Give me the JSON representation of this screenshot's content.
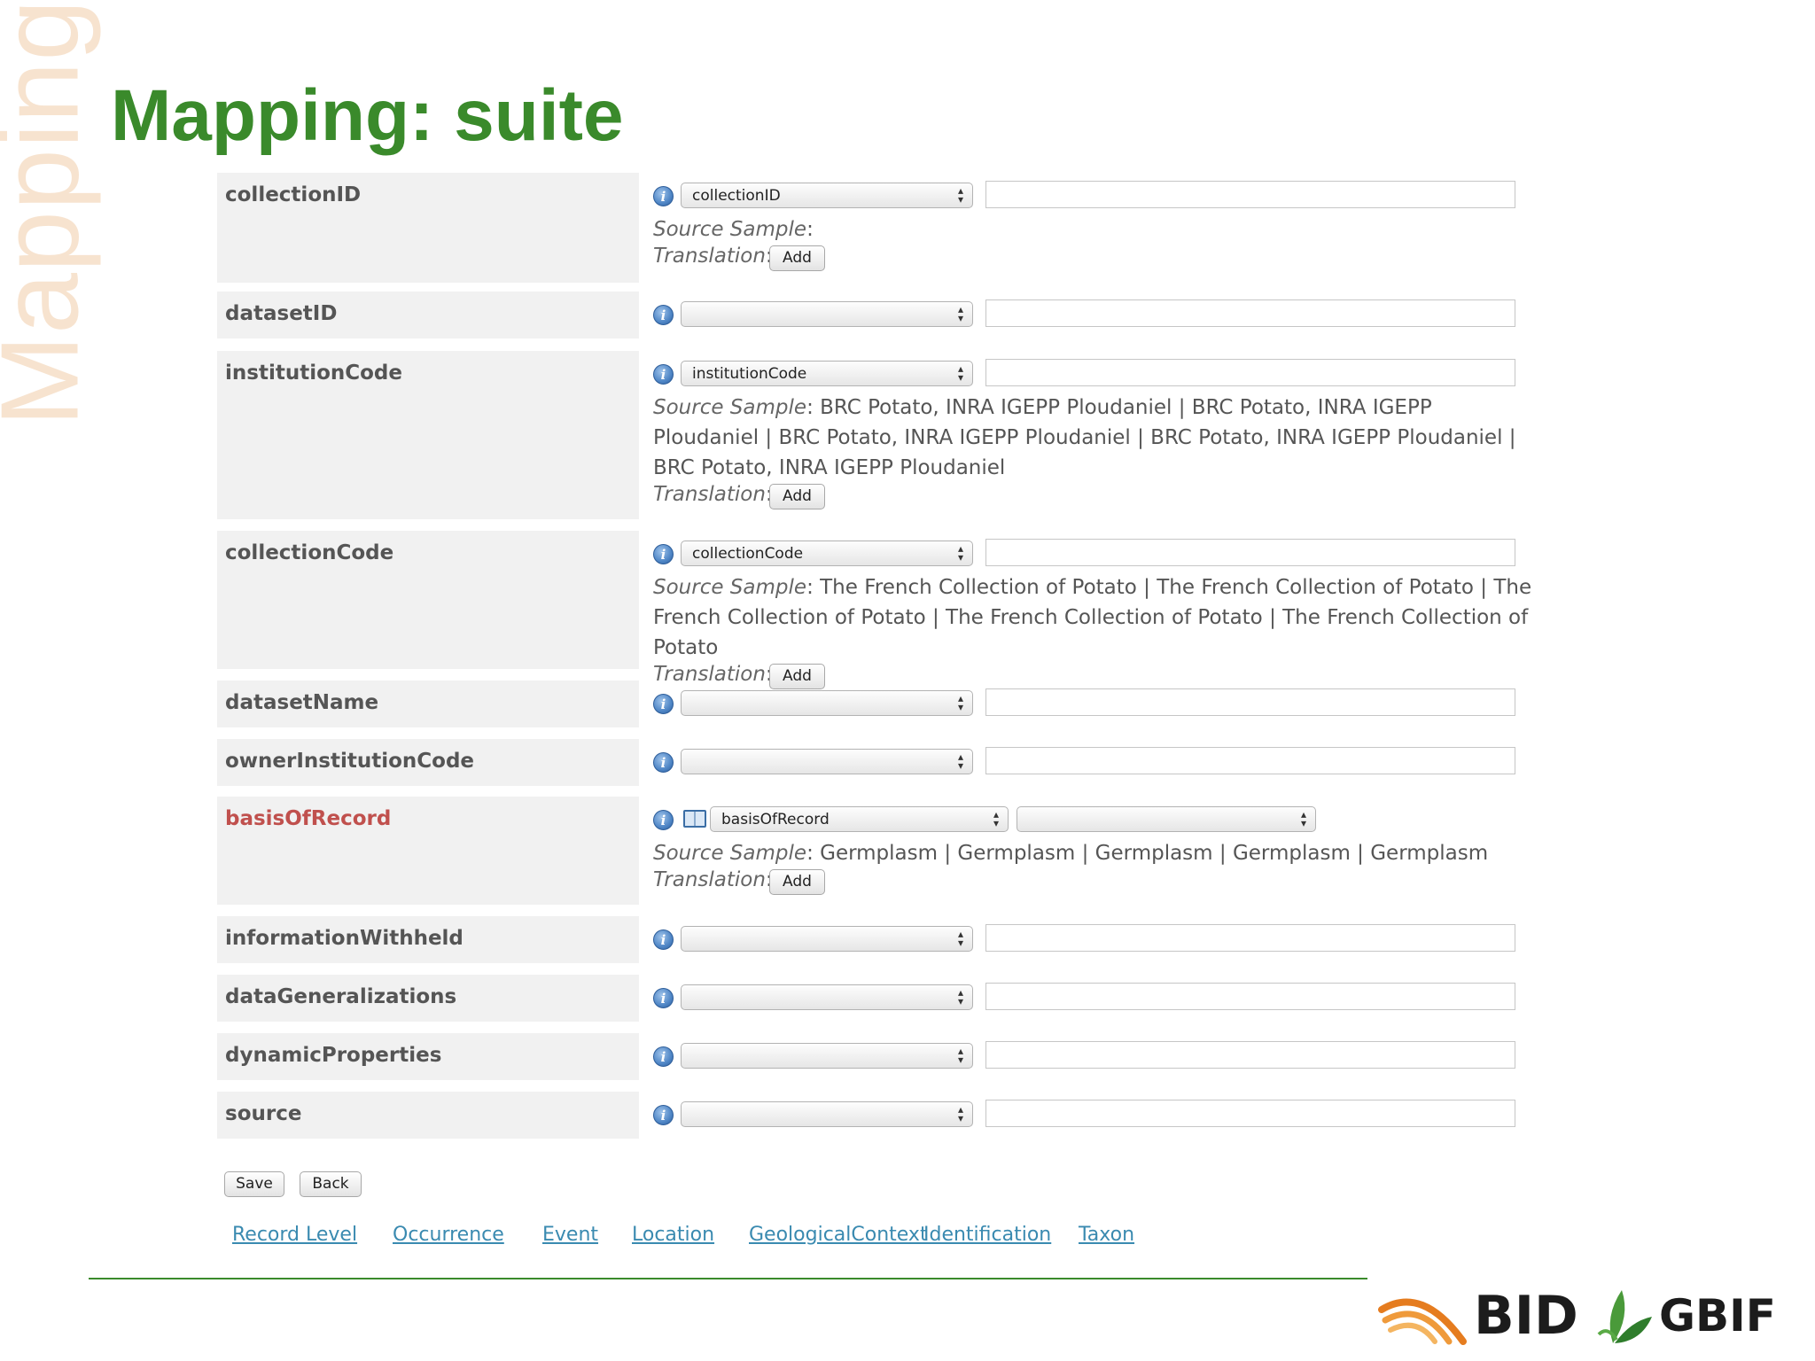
{
  "side_title": "Mapping",
  "slide_title": "Mapping: suite",
  "labels": {
    "source_sample": "Source Sample",
    "translation": "Translation",
    "add_button": "Add"
  },
  "rows": [
    {
      "field": "collectionID",
      "selected": "collectionID",
      "sample": ""
    },
    {
      "field": "datasetID",
      "selected": ""
    },
    {
      "field": "institutionCode",
      "selected": "institutionCode",
      "sample": "BRC Potato, INRA IGEPP Ploudaniel | BRC Potato, INRA IGEPP Ploudaniel | BRC Potato, INRA IGEPP Ploudaniel | BRC Potato, INRA IGEPP Ploudaniel | BRC Potato, INRA IGEPP Ploudaniel"
    },
    {
      "field": "collectionCode",
      "selected": "collectionCode",
      "sample": "The French Collection of Potato | The French Collection of Potato | The French Collection of Potato | The French Collection of Potato | The French Collection of Potato"
    },
    {
      "field": "datasetName",
      "selected": ""
    },
    {
      "field": "ownerInstitutionCode",
      "selected": ""
    },
    {
      "field": "basisOfRecord",
      "required": true,
      "selected": "basisOfRecord",
      "vocab_selected": "",
      "sample": "Germplasm | Germplasm | Germplasm | Germplasm | Germplasm"
    },
    {
      "field": "informationWithheld",
      "selected": ""
    },
    {
      "field": "dataGeneralizations",
      "selected": ""
    },
    {
      "field": "dynamicProperties",
      "selected": ""
    },
    {
      "field": "source",
      "selected": ""
    }
  ],
  "buttons": {
    "save": "Save",
    "back": "Back"
  },
  "nav": [
    "Record Level",
    "Occurrence",
    "Event",
    "Location",
    "GeologicalContext",
    "Identification",
    "Taxon"
  ],
  "logos": {
    "bid": "BID",
    "gbif": "GBIF"
  },
  "colors": {
    "title_green": "#3a8a2b",
    "required_red": "#c0504d",
    "link_blue": "#3a8ab0",
    "side_word": "#f7e3cf"
  },
  "icons": {
    "info": "info-icon",
    "vocabulary": "book-icon",
    "select_arrows": "updown-arrows-icon"
  }
}
